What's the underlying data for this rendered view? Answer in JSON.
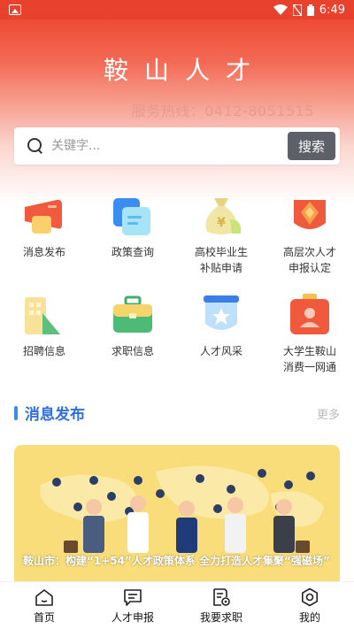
{
  "status_bar": {
    "time": "6:49"
  },
  "header": {
    "title": "鞍山人才",
    "hotline": "服务热线：0412-8051515"
  },
  "search": {
    "placeholder": "关键字...",
    "button_label": "搜索"
  },
  "grid": [
    {
      "label": "消息发布",
      "icon": "megaphone-icon"
    },
    {
      "label": "政策查询",
      "icon": "policy-document-icon"
    },
    {
      "label": "高校毕业生\n补贴申请",
      "icon": "money-bag-icon"
    },
    {
      "label": "高层次人才\n申报认定",
      "icon": "diamond-award-icon"
    },
    {
      "label": "招聘信息",
      "icon": "building-icon"
    },
    {
      "label": "求职信息",
      "icon": "briefcase-icon"
    },
    {
      "label": "人才风采",
      "icon": "star-badge-icon"
    },
    {
      "label": "大学生鞍山\n消费一网通",
      "icon": "id-card-icon"
    }
  ],
  "news_section": {
    "title": "消息发布",
    "more": "更多",
    "banner_caption": "鞍山市：构建“1+54”人才政策体系 全力打造人才集聚“强磁场”"
  },
  "tabbar": [
    {
      "label": "首页",
      "icon": "home-icon"
    },
    {
      "label": "人才申报",
      "icon": "message-icon"
    },
    {
      "label": "我要求职",
      "icon": "job-search-icon"
    },
    {
      "label": "我的",
      "icon": "settings-icon"
    }
  ],
  "colors": {
    "header_red": "#e8422e",
    "accent_blue": "#2f6fe0",
    "search_button": "#5d6069",
    "banner_yellow": "#f9dd7a"
  }
}
